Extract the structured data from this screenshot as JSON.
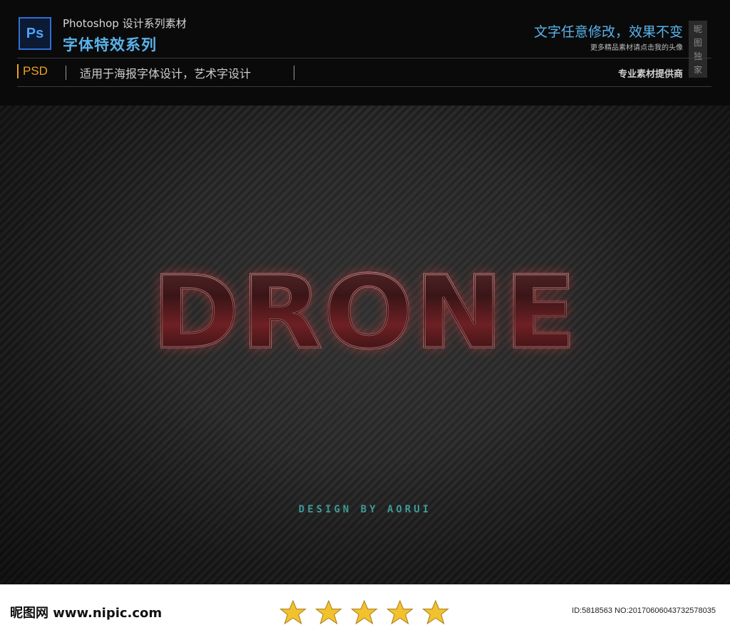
{
  "header": {
    "logo_text": "Ps",
    "title_line1": "Photoshop 设计系列素材",
    "title_line2": "字体特效系列",
    "psd_tag": "PSD",
    "usage": "适用于海报字体设计，艺术字设计",
    "slogan": "文字任意修改，效果不变",
    "slogan_sub": "更多精品素材请点击我的头像",
    "provider": "专业素材提供商",
    "exclusive": [
      "昵",
      "图",
      "独",
      "家"
    ]
  },
  "artwork": {
    "headline": "DRONE",
    "credit": "DESIGN BY AORUI"
  },
  "footer": {
    "site": "昵图网 www.nipic.com",
    "rating": 5,
    "id_text": "ID:5818563 NO:20170606043732578035"
  },
  "colors": {
    "accent_blue": "#5ab3ea",
    "psd_orange": "#f0a020",
    "headline_red": "#c0303a",
    "credit_teal": "#3f9a98",
    "star_gold": "#f2c12e"
  }
}
